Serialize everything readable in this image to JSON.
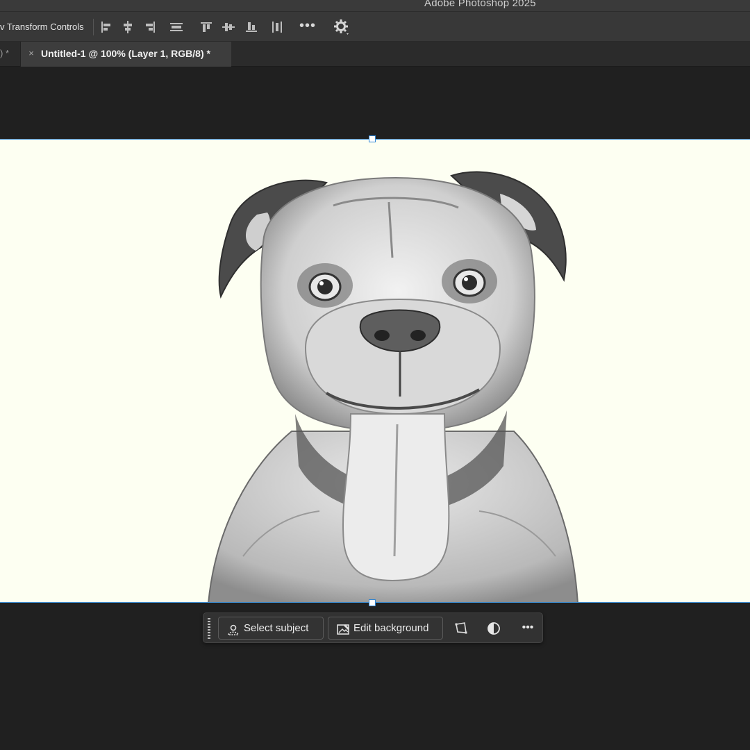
{
  "app": {
    "title": "Adobe Photoshop 2025"
  },
  "options_bar": {
    "transform_controls_label": "v Transform Controls",
    "more_label": "•••"
  },
  "tabs": {
    "previous_tab_label": ") *",
    "active_tab_title": "Untitled-1 @ 100% (Layer 1, RGB/8) *",
    "close_symbol": "×"
  },
  "taskbar": {
    "select_subject_label": "Select subject",
    "edit_background_label": "Edit background",
    "more_label": "•••"
  },
  "colors": {
    "canvas_background": "#fdfff2",
    "selection_border": "#3d8fd4",
    "ui_dark": "#202020"
  }
}
